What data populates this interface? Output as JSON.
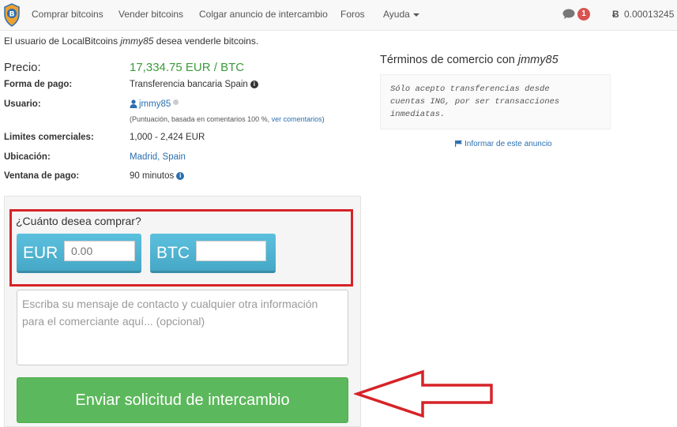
{
  "nav": {
    "items": [
      "Comprar bitcoins",
      "Vender bitcoins",
      "Colgar anuncio de intercambio",
      "Foros",
      "Ayuda"
    ],
    "notifications": "1",
    "btc_symbol": "Ƀ",
    "balance": "0.00013245"
  },
  "intro": {
    "prefix": "El usuario de LocalBitcoins ",
    "user": "jmmy85",
    "suffix": " desea venderle bitcoins."
  },
  "details": {
    "price_label": "Precio:",
    "price_value": "17,334.75 EUR / BTC",
    "payment_label": "Forma de pago:",
    "payment_value": "Transferencia bancaria Spain",
    "user_label": "Usuario:",
    "user_value": "jmmy85",
    "user_score_prefix": "(Puntuación, basada en comentarios 100 %, ",
    "user_score_link": "ver comentarios",
    "user_score_suffix": ")",
    "limits_label": "Limites comerciales:",
    "limits_value": "1,000 - 2,424 EUR",
    "location_label": "Ubicación:",
    "location_value": "Madrid, Spain",
    "window_label": "Ventana de pago:",
    "window_value": "90 minutos"
  },
  "terms": {
    "title_prefix": "Términos de comercio con ",
    "title_user": "jmmy85",
    "lines": [
      "Sólo acepto transferencias desde",
      "cuentas ING, por ser transacciones",
      "inmediatas."
    ],
    "report": "Informar de este anuncio"
  },
  "form": {
    "question": "¿Cuánto desea comprar?",
    "eur_label": "EUR",
    "eur_placeholder": "0.00",
    "btc_label": "BTC",
    "btc_value": "",
    "message_placeholder_line1": "Escriba su mensaje de contacto y cualquier otra información",
    "message_placeholder_line2": "para el comerciante aquí... (opcional)",
    "submit": "Enviar solicitud de intercambio"
  },
  "colors": {
    "price": "#3c9a3c",
    "highlight": "#d62328",
    "submit": "#5cb85c",
    "currency": "#5bc0de"
  }
}
